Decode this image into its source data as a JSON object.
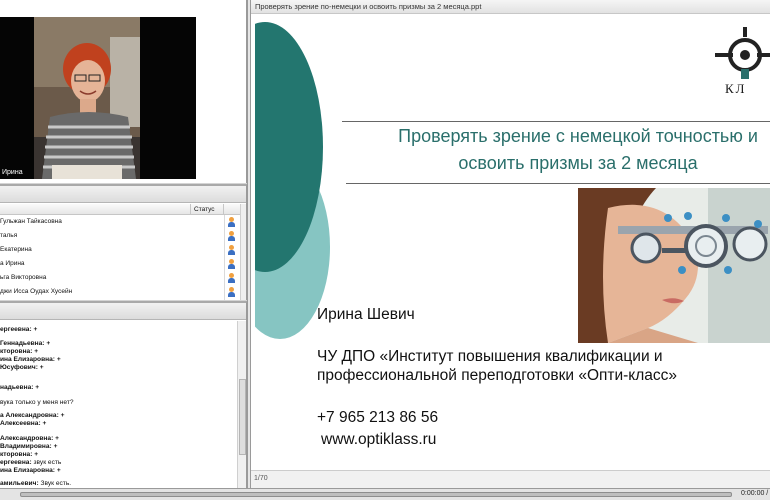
{
  "video": {
    "participant_name": "Ирина"
  },
  "attendees": {
    "status_header": "Статус",
    "rows": [
      {
        "name": "Гульжан Тайкасовна",
        "icon": "raise-hand-icon"
      },
      {
        "name": "талья",
        "icon": "raise-hand-icon"
      },
      {
        "name": "Екатерина",
        "icon": "raise-hand-icon"
      },
      {
        "name": "а Ирина",
        "icon": "raise-hand-icon"
      },
      {
        "name": "ьга Викторовна",
        "icon": "raise-hand-icon"
      },
      {
        "name": "джи Исса  Оудах Хусейн",
        "icon": "raise-hand-icon"
      }
    ]
  },
  "chat": {
    "messages": [
      {
        "sender": "ергеевна: +",
        "text": ""
      },
      {
        "sender": "Геннадьевна: +",
        "text": ""
      },
      {
        "sender": "кторовна: +",
        "text": ""
      },
      {
        "sender": "ина  Елизаровна: +",
        "text": ""
      },
      {
        "sender": "Юсуфович: +",
        "text": ""
      },
      {
        "sender": "",
        "text": ""
      },
      {
        "sender": "надьевна: +",
        "text": ""
      },
      {
        "sender": "",
        "text": ""
      },
      {
        "sender": "",
        "text": "вука только у меня нет?"
      },
      {
        "sender": "",
        "text": ""
      },
      {
        "sender": "а Александровна: +",
        "text": ""
      },
      {
        "sender": " Алексеевна: +",
        "text": ""
      },
      {
        "sender": "",
        "text": ""
      },
      {
        "sender": "Александровна: +",
        "text": ""
      },
      {
        "sender": " Владимировна: +",
        "text": ""
      },
      {
        "sender": "кторовна: +",
        "text": ""
      },
      {
        "sender": "ергеевна:",
        "text": "звук есть"
      },
      {
        "sender": "ина  Елизаровна: +",
        "text": ""
      },
      {
        "sender": "",
        "text": ""
      },
      {
        "sender": "амильевич:",
        "text": "Звук есть."
      }
    ]
  },
  "share": {
    "document_title": "Проверять зрение по-немецки и освоить призмы за 2 месяца.ppt",
    "page_indicator": "1/70"
  },
  "slide": {
    "title_line1": "Проверять зрение с немецкой точностью и",
    "title_line2": "освоить призмы за 2 месяца",
    "logo_text": "КЛ",
    "speaker": "Ирина Шевич",
    "org_line1": "ЧУ ДПО «Институт повышения квалификации и",
    "org_line2": "профессиональной переподготовки «Опти-класс»",
    "phone": "+7 965 213 86 56",
    "website": "www.optiklass.ru",
    "accent_color": "#1f6e68"
  },
  "playback": {
    "time": "0:00:00 /"
  }
}
